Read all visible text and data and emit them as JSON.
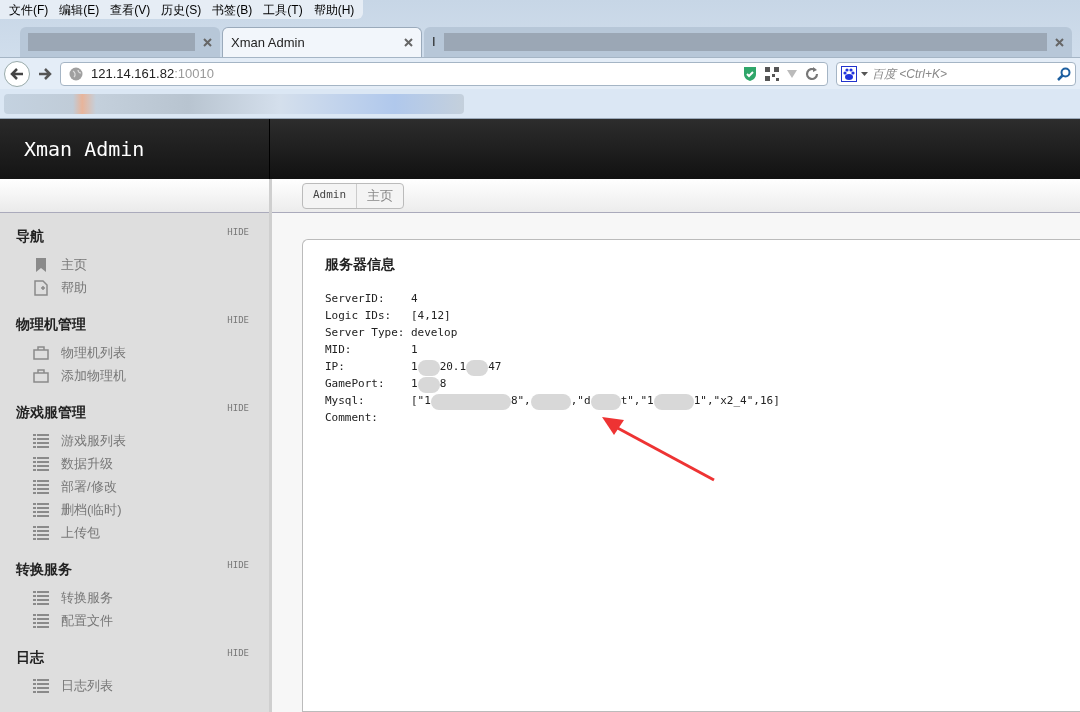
{
  "menu_bar": [
    "文件(F)",
    "编辑(E)",
    "查看(V)",
    "历史(S)",
    "书签(B)",
    "工具(T)",
    "帮助(H)"
  ],
  "tabs": [
    {
      "selected": false
    },
    {
      "title_parts": [
        "Xman Admin"
      ],
      "selected": true
    },
    {
      "title_parts": [
        "I"
      ],
      "selected": false
    }
  ],
  "address": {
    "host": "121.14.161.82",
    "port": ":10010"
  },
  "search": {
    "placeholder": "百度 <Ctrl+K>"
  },
  "app": {
    "title": "Xman Admin"
  },
  "breadcrumb": [
    {
      "label": "Admin",
      "selected": false
    },
    {
      "label": "主页",
      "selected": true
    }
  ],
  "sidebar": [
    {
      "title": "导航",
      "hide": "HIDE",
      "items": [
        {
          "label": "主页",
          "kind": "bookmark"
        },
        {
          "label": "帮助",
          "kind": "doc"
        }
      ]
    },
    {
      "title": "物理机管理",
      "hide": "HIDE",
      "items": [
        {
          "label": "物理机列表",
          "kind": "case"
        },
        {
          "label": "添加物理机",
          "kind": "case"
        }
      ]
    },
    {
      "title": "游戏服管理",
      "hide": "HIDE",
      "items": [
        {
          "label": "游戏服列表",
          "kind": "list"
        },
        {
          "label": "数据升级",
          "kind": "list"
        },
        {
          "label": "部署/修改",
          "kind": "list"
        },
        {
          "label": "删档(临时)",
          "kind": "list"
        },
        {
          "label": "上传包",
          "kind": "list"
        }
      ]
    },
    {
      "title": "转换服务",
      "hide": "HIDE",
      "items": [
        {
          "label": "转换服务",
          "kind": "list"
        },
        {
          "label": "配置文件",
          "kind": "list"
        }
      ]
    },
    {
      "title": "日志",
      "hide": "HIDE",
      "items": [
        {
          "label": "日志列表",
          "kind": "list"
        }
      ]
    }
  ],
  "panel": {
    "title": "服务器信息",
    "rows": [
      {
        "label": "ServerID:",
        "value_parts": [
          "4"
        ]
      },
      {
        "label": "Logic IDs:",
        "value_parts": [
          "[4,12]"
        ]
      },
      {
        "label": "Server Type:",
        "value_parts": [
          "develop"
        ]
      },
      {
        "label": "MID:",
        "value_parts": [
          "1"
        ]
      },
      {
        "label": "IP:",
        "value_parts": [
          "1",
          "20.1",
          "47"
        ]
      },
      {
        "label": "GamePort:",
        "value_parts": [
          "1",
          "8"
        ]
      },
      {
        "label": "Mysql:",
        "value_parts": [
          "[\"1",
          "8\",",
          ",\"d",
          "t\",\"1",
          "1\",\"x2_4\",16]"
        ]
      },
      {
        "label": "Comment:",
        "value_parts": []
      }
    ]
  }
}
